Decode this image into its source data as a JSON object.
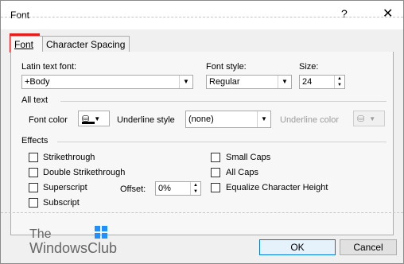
{
  "dialog": {
    "title": "Font",
    "help": "?",
    "close": "✕"
  },
  "tabs": [
    {
      "label": "Font",
      "active": true
    },
    {
      "label": "Character Spacing",
      "active": false
    }
  ],
  "font_section": {
    "latin_label": "Latin text font:",
    "latin_value": "+Body",
    "style_label": "Font style:",
    "style_value": "Regular",
    "size_label": "Size:",
    "size_value": "24"
  },
  "all_text": {
    "header": "All text",
    "font_color_label": "Font color",
    "underline_style_label": "Underline style",
    "underline_style_value": "(none)",
    "underline_color_label": "Underline color"
  },
  "effects": {
    "header": "Effects",
    "items": [
      {
        "label": "Strikethrough",
        "checked": false
      },
      {
        "label": "Double Strikethrough",
        "checked": false
      },
      {
        "label": "Superscript",
        "checked": false
      },
      {
        "label": "Subscript",
        "checked": false
      },
      {
        "label": "Small Caps",
        "checked": false
      },
      {
        "label": "All Caps",
        "checked": false
      },
      {
        "label": "Equalize Character Height",
        "checked": false
      }
    ],
    "offset_label": "Offset:",
    "offset_value": "0%"
  },
  "buttons": {
    "ok": "OK",
    "cancel": "Cancel"
  },
  "watermark": {
    "line1": "The",
    "line2": "WindowsClub"
  },
  "colors": {
    "highlight_outline": "#e21d1d",
    "ok_border": "#0078d7"
  }
}
